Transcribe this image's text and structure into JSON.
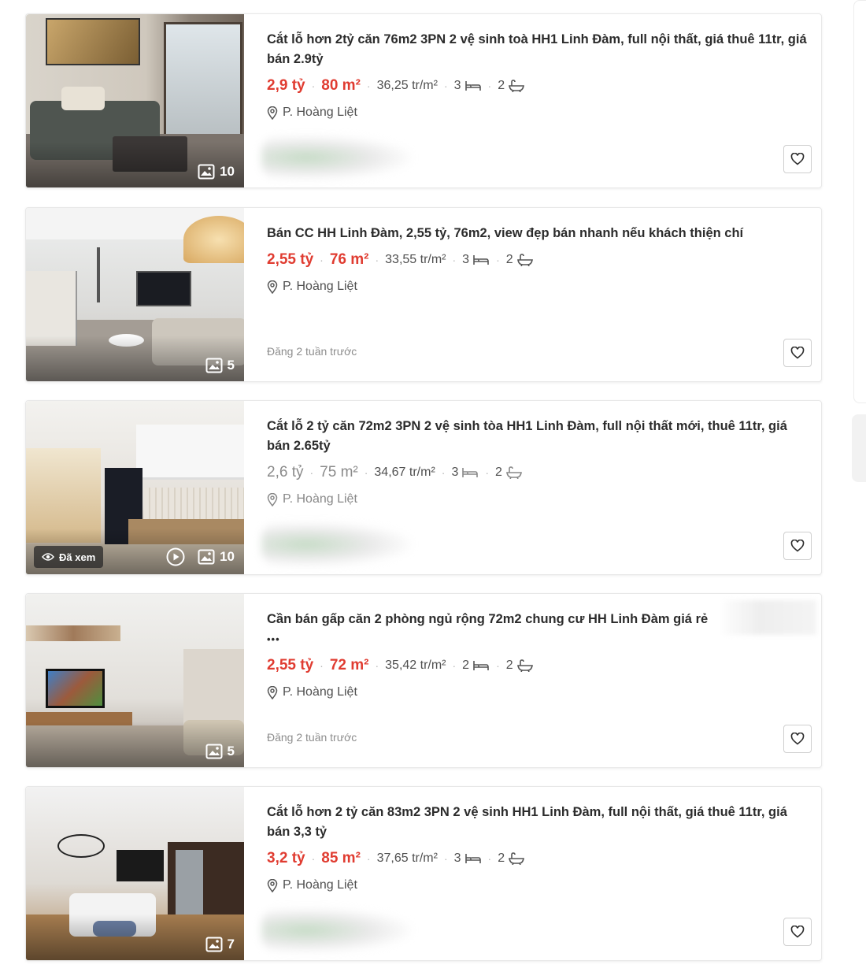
{
  "listings": [
    {
      "title": "Cắt lỗ hơn 2tỷ căn 76m2 3PN 2 vệ sinh toà HH1 Linh Đàm, full nội thất, giá thuê 11tr, giá bán 2.9tỷ",
      "price": "2,9 tỷ",
      "area": "80 m²",
      "price_per_m2": "36,25 tr/m²",
      "bedrooms": "3",
      "bathrooms": "2",
      "location": "P. Hoàng Liệt",
      "photo_count": "10",
      "posted": "",
      "seen": false
    },
    {
      "title": "Bán CC HH Linh Đàm, 2,55 tỷ, 76m2, view đẹp bán nhanh nếu khách thiện chí",
      "price": "2,55 tỷ",
      "area": "76 m²",
      "price_per_m2": "33,55 tr/m²",
      "bedrooms": "3",
      "bathrooms": "2",
      "location": "P. Hoàng Liệt",
      "photo_count": "5",
      "posted": "Đăng 2 tuần trước",
      "seen": false
    },
    {
      "title": "Cắt lỗ 2 tỷ căn 72m2 3PN 2 vệ sinh tòa HH1 Linh Đàm, full nội thất mới, thuê 11tr, giá bán 2.65tỷ",
      "price": "2,6 tỷ",
      "area": "75 m²",
      "price_per_m2": "34,67 tr/m²",
      "bedrooms": "3",
      "bathrooms": "2",
      "location": "P. Hoàng Liệt",
      "photo_count": "10",
      "posted": "",
      "seen": true,
      "seen_label": "Đã xem"
    },
    {
      "title": "Cần bán gấp căn 2 phòng ngủ rộng 72m2 chung cư HH Linh Đàm giá rẻ",
      "title_more": "•••",
      "price": "2,55 tỷ",
      "area": "72 m²",
      "price_per_m2": "35,42 tr/m²",
      "bedrooms": "2",
      "bathrooms": "2",
      "location": "P. Hoàng Liệt",
      "photo_count": "5",
      "posted": "Đăng 2 tuần trước",
      "seen": false
    },
    {
      "title": "Cắt lỗ hơn 2 tỷ căn 83m2 3PN 2 vệ sinh HH1 Linh Đàm, full nội thất, giá thuê 11tr, giá bán 3,3 tỷ",
      "price": "3,2 tỷ",
      "area": "85 m²",
      "price_per_m2": "37,65 tr/m²",
      "bedrooms": "3",
      "bathrooms": "2",
      "location": "P. Hoàng Liệt",
      "photo_count": "7",
      "posted": "",
      "seen": false
    }
  ],
  "colors": {
    "price_red": "#e03c31",
    "text": "#2c2c2c",
    "muted": "#505050"
  }
}
